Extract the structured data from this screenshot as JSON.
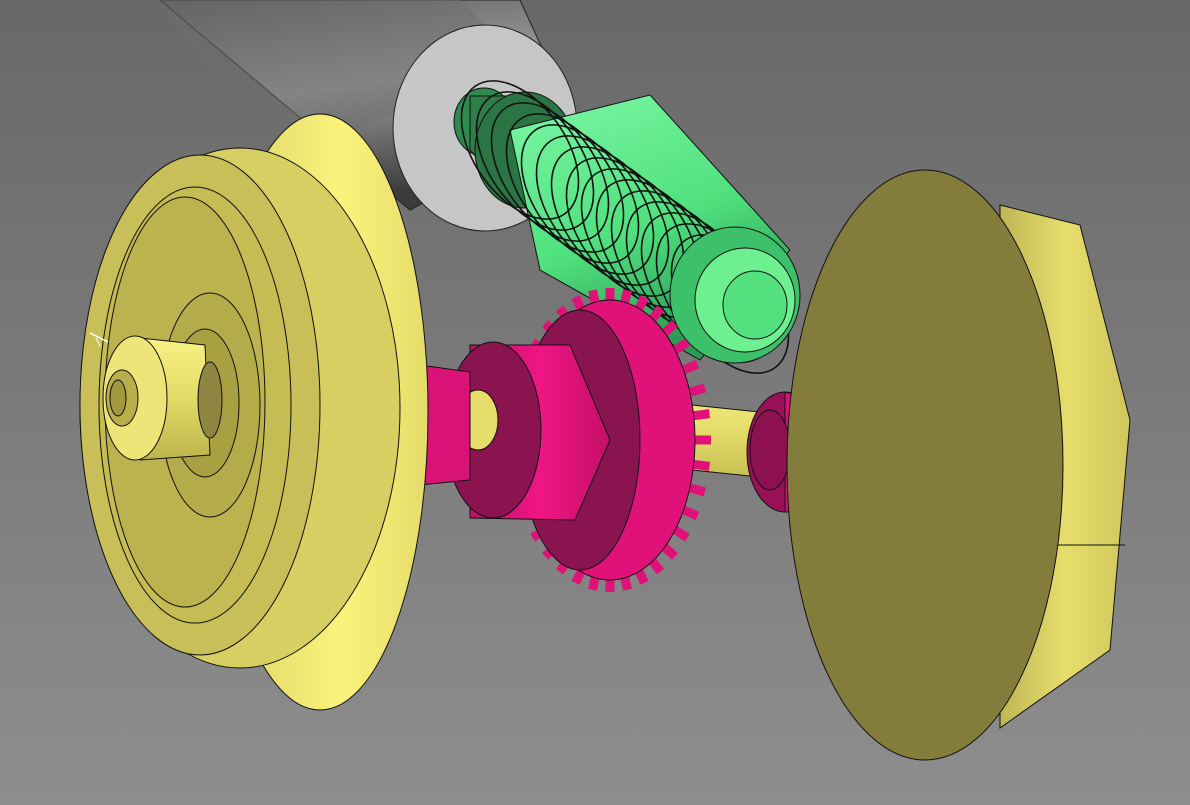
{
  "viewer": {
    "background_top": "#696969",
    "background_bottom": "#8e8e8e"
  },
  "model": {
    "parts": [
      {
        "name": "motor-shaft",
        "color": "#8a8a8a"
      },
      {
        "name": "motor-face",
        "color": "#c4c4c4"
      },
      {
        "name": "worm-screw",
        "color": "#5cf08a"
      },
      {
        "name": "worm-shaft",
        "color": "#2e7d4a"
      },
      {
        "name": "spur-gear",
        "color": "#e4137a"
      },
      {
        "name": "gear-hub",
        "color": "#8b1450"
      },
      {
        "name": "axle",
        "color": "#e8e06e"
      },
      {
        "name": "wheel-left",
        "color": "#f0e86e"
      },
      {
        "name": "wheel-right",
        "color": "#8a8240"
      }
    ]
  }
}
